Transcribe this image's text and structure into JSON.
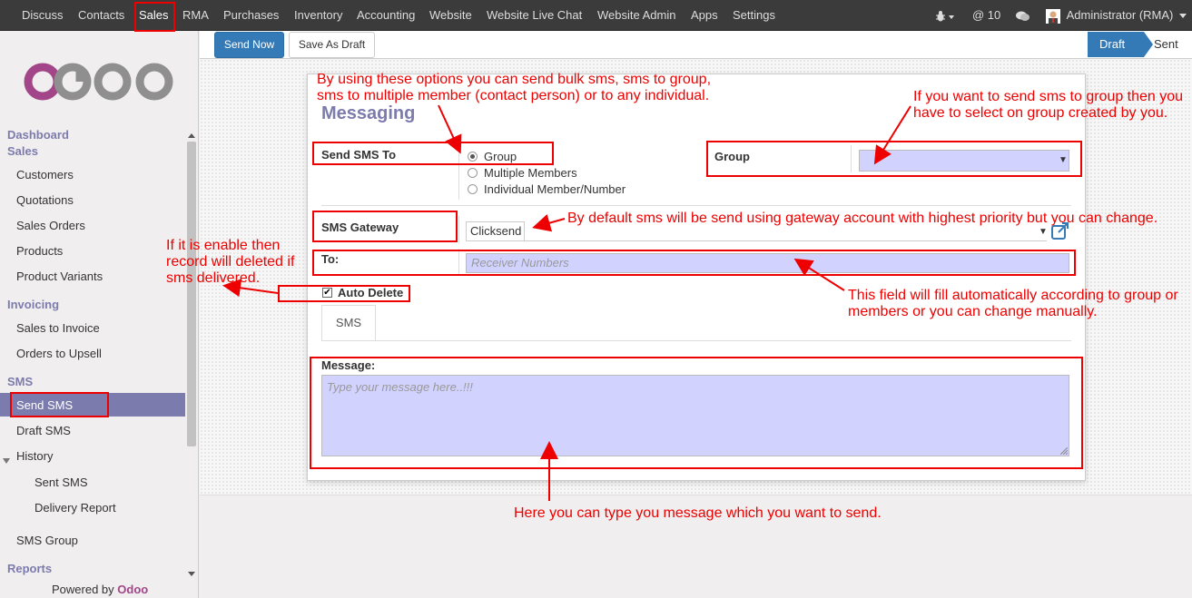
{
  "topbar": {
    "menu": [
      "Discuss",
      "Contacts",
      "Sales",
      "RMA",
      "Purchases",
      "Inventory",
      "Accounting",
      "Website",
      "Website Live Chat",
      "Website Admin",
      "Apps",
      "Settings"
    ],
    "mentions": "@ 10",
    "user": "Administrator (RMA)"
  },
  "sidebar": {
    "logo": "odoo",
    "dashboard": "Dashboard",
    "sales_head": "Sales",
    "sales_items": [
      "Customers",
      "Quotations",
      "Sales Orders",
      "Products",
      "Product Variants"
    ],
    "invoicing_head": "Invoicing",
    "invoicing_items": [
      "Sales to Invoice",
      "Orders to Upsell"
    ],
    "sms_head": "SMS",
    "sms_items": [
      "Send SMS",
      "Draft SMS"
    ],
    "history": "History",
    "history_items": [
      "Sent SMS",
      "Delivery Report"
    ],
    "sms_group": "SMS Group",
    "reports_head": "Reports",
    "powered_by": "Powered by",
    "powered_brand": "Odoo"
  },
  "controls": {
    "send_now": "Send Now",
    "save_draft": "Save As Draft",
    "status_draft": "Draft",
    "status_sent": "Sent"
  },
  "form": {
    "title": "Messaging",
    "send_sms_to_label": "Send SMS To",
    "radio_options": [
      "Group",
      "Multiple Members",
      "Individual Member/Number"
    ],
    "selected_option": "Group",
    "group_label": "Group",
    "group_value": "",
    "gateway_label": "SMS Gateway",
    "gateway_value": "Clicksend",
    "to_label": "To:",
    "to_placeholder": "Receiver Numbers",
    "auto_delete_label": "Auto Delete",
    "auto_delete_checked": true,
    "tab": "SMS",
    "message_label": "Message:",
    "message_placeholder": "Type your message here..!!!"
  },
  "annotations": {
    "options_note": [
      "By using these options you can send bulk sms, sms to group,",
      "sms to multiple member (contact person) or to any individual."
    ],
    "group_note": [
      "If you want to send sms to group then you",
      "have to select on group created by you."
    ],
    "gateway_note": "By default sms will be send using gateway account with highest priority but you can change.",
    "autodelete_note": [
      "If it is enable then",
      "record will deleted if",
      "sms delivered."
    ],
    "to_note": [
      "This field will fill automatically according to group or",
      "members or you can change manually."
    ],
    "message_note": "Here you can type you message which you want to send."
  },
  "colors": {
    "accent": "#7c7bad",
    "primary": "#337ab7",
    "annotation": "#ee0000",
    "field_bg": "#d2d2ff"
  }
}
